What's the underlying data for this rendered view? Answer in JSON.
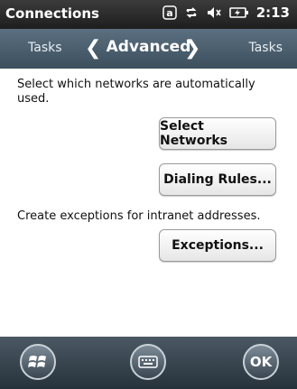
{
  "status_bar": {
    "title": "Connections",
    "time": "2:13",
    "icons": [
      "a-keyboard-mode-icon",
      "data-transfer-icon",
      "volume-muted-icon",
      "battery-charging-icon"
    ]
  },
  "tabs": {
    "left": "Tasks",
    "center": "Advanced",
    "right": "Tasks"
  },
  "content": {
    "networks_text": "Select which networks are automatically used.",
    "select_networks_button": "Select Networks",
    "dialing_rules_button": "Dialing Rules...",
    "exceptions_text": "Create exceptions for intranet addresses.",
    "exceptions_button": "Exceptions..."
  },
  "bottom_bar": {
    "ok_label": "OK"
  }
}
